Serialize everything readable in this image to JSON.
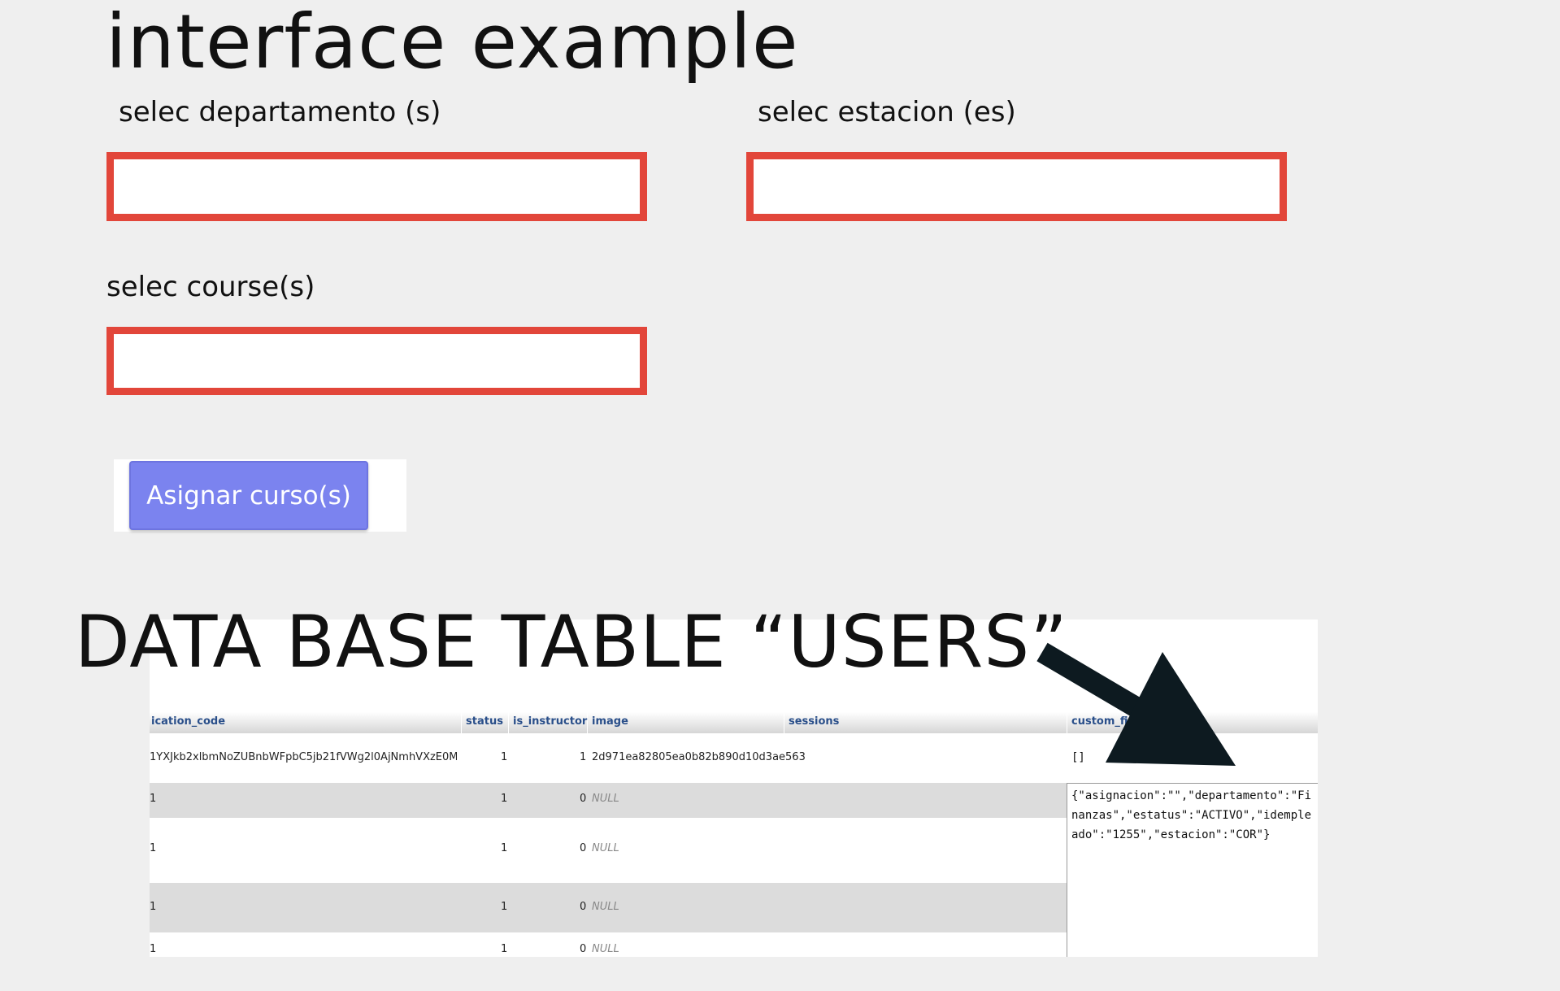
{
  "page": {
    "title": "interface example"
  },
  "form": {
    "departamento_label": "selec departamento (s)",
    "estacion_label": "selec estacion (es)",
    "course_label": "selec course(s)",
    "assign_button_label": "Asignar curso(s)"
  },
  "database": {
    "title": "DATA BASE TABLE “USERS”",
    "columns": [
      "ication_code",
      "status",
      "is_instructor",
      "image",
      "sessions",
      "custom_field"
    ],
    "rows": [
      {
        "code": "1YXJkb2xlbmNoZUBnbWFpbC5jb21fVWg2l0AjNmhVXzE0MD...",
        "status": "1",
        "is_instructor": "1",
        "image": "2d971ea82805ea0b82b890d10d3ae563",
        "custom_field": "[]"
      },
      {
        "code": "1",
        "status": "1",
        "is_instructor": "0",
        "image": "NULL"
      },
      {
        "code": "1",
        "status": "1",
        "is_instructor": "0",
        "image": "NULL"
      },
      {
        "code": "1",
        "status": "1",
        "is_instructor": "0",
        "image": "NULL"
      },
      {
        "code": "1",
        "status": "1",
        "is_instructor": "0",
        "image": "NULL"
      }
    ],
    "custom_field_json": "{\"asignacion\":\"\",\"departamento\":\"Finanzas\",\"estatus\":\"ACTIVO\",\"idempleado\":\"1255\",\"estacion\":\"COR\"}"
  },
  "colors": {
    "input_border": "#e2463a",
    "button_bg": "#7b83ef",
    "header_text": "#2a4f8a",
    "arrow": "#0d1a20"
  }
}
